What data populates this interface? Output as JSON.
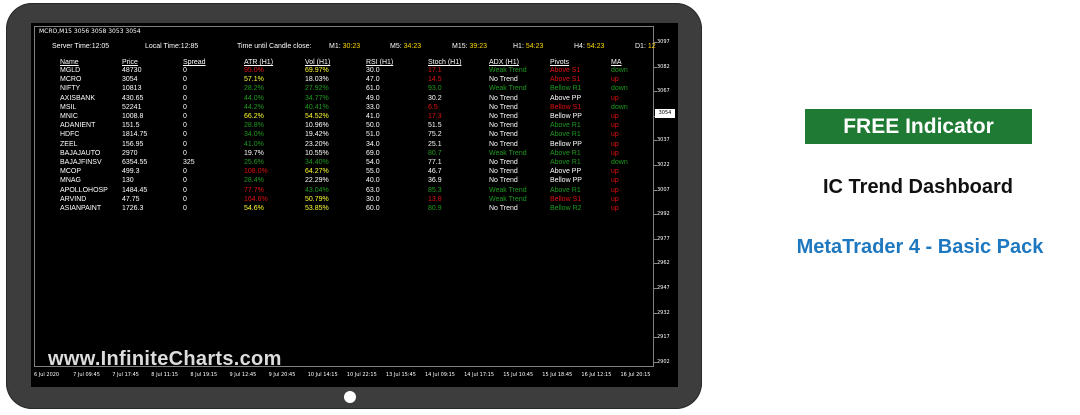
{
  "header": {
    "symbol_line": "MCRO,M15  3056 3058 3053 3054",
    "server_time_label": "Server Time:",
    "server_time": "12:05",
    "local_time_label": "Local Time:",
    "local_time": "12:85",
    "candle_label": "Time until Candle close:",
    "timers": [
      {
        "tf": "M1:",
        "value": "30:23"
      },
      {
        "tf": "M5:",
        "value": "34:23"
      },
      {
        "tf": "M15:",
        "value": "39:23"
      },
      {
        "tf": "H1:",
        "value": "54:23"
      },
      {
        "tf": "H4:",
        "value": "54:23"
      },
      {
        "tf": "D1:",
        "value": "12"
      }
    ]
  },
  "columns": [
    "Name",
    "Price",
    "Spread",
    "ATR (H1)",
    "Vol (H1)",
    "RSI (H1)",
    "Stoch (H1)",
    "ADX (H1)",
    "Pivots",
    "MA"
  ],
  "colors": {
    "white": "#ffffff",
    "red": "#e01010",
    "green": "#1e9a1e",
    "yellow": "#ffff33"
  },
  "rows": [
    {
      "name": "MGLD",
      "price": "48730",
      "spread": "0",
      "atr": "95.0%",
      "atr_c": "red",
      "vol": "69.97%",
      "vol_c": "yellow",
      "rsi": "30.0",
      "stoch": "17.1",
      "stoch_c": "red",
      "adx": "Weak Trend",
      "adx_c": "green",
      "pivots": "Above S1",
      "piv_c": "red",
      "ma": "down",
      "ma_c": "green"
    },
    {
      "name": "MCRO",
      "price": "3054",
      "spread": "0",
      "atr": "57.1%",
      "atr_c": "yellow",
      "vol": "18.03%",
      "vol_c": "white",
      "rsi": "47.0",
      "stoch": "14.5",
      "stoch_c": "red",
      "adx": "No Trend",
      "adx_c": "white",
      "pivots": "Above S1",
      "piv_c": "red",
      "ma": "up",
      "ma_c": "red"
    },
    {
      "name": "NIFTY",
      "price": "10813",
      "spread": "0",
      "atr": "28.2%",
      "atr_c": "green",
      "vol": "27.92%",
      "vol_c": "green",
      "rsi": "61.0",
      "stoch": "93.0",
      "stoch_c": "green",
      "adx": "Weak Trend",
      "adx_c": "green",
      "pivots": "Bellow R1",
      "piv_c": "green",
      "ma": "down",
      "ma_c": "green"
    },
    {
      "name": "AXISBANK",
      "price": "430.65",
      "spread": "0",
      "atr": "44.0%",
      "atr_c": "green",
      "vol": "34.77%",
      "vol_c": "green",
      "rsi": "49.0",
      "stoch": "30.2",
      "stoch_c": "white",
      "adx": "No Trend",
      "adx_c": "white",
      "pivots": "Above PP",
      "piv_c": "white",
      "ma": "up",
      "ma_c": "red"
    },
    {
      "name": "MSIL",
      "price": "52241",
      "spread": "0",
      "atr": "44.2%",
      "atr_c": "green",
      "vol": "40.41%",
      "vol_c": "green",
      "rsi": "33.0",
      "stoch": "6.5",
      "stoch_c": "red",
      "adx": "No Trend",
      "adx_c": "white",
      "pivots": "Bellow S1",
      "piv_c": "red",
      "ma": "down",
      "ma_c": "green"
    },
    {
      "name": "MNIC",
      "price": "1008.8",
      "spread": "0",
      "atr": "66.2%",
      "atr_c": "yellow",
      "vol": "54.52%",
      "vol_c": "yellow",
      "rsi": "41.0",
      "stoch": "17.3",
      "stoch_c": "red",
      "adx": "No Trend",
      "adx_c": "white",
      "pivots": "Bellow PP",
      "piv_c": "white",
      "ma": "up",
      "ma_c": "red"
    },
    {
      "name": "ADANIENT",
      "price": "151.5",
      "spread": "0",
      "atr": "28.8%",
      "atr_c": "green",
      "vol": "10.96%",
      "vol_c": "white",
      "rsi": "50.0",
      "stoch": "51.5",
      "stoch_c": "white",
      "adx": "No Trend",
      "adx_c": "white",
      "pivots": "Above R1",
      "piv_c": "green",
      "ma": "up",
      "ma_c": "red"
    },
    {
      "name": "HDFC",
      "price": "1814.75",
      "spread": "0",
      "atr": "34.0%",
      "atr_c": "green",
      "vol": "19.42%",
      "vol_c": "white",
      "rsi": "51.0",
      "stoch": "75.2",
      "stoch_c": "white",
      "adx": "No Trend",
      "adx_c": "white",
      "pivots": "Above R1",
      "piv_c": "green",
      "ma": "up",
      "ma_c": "red"
    },
    {
      "name": "ZEEL",
      "price": "156.95",
      "spread": "0",
      "atr": "41.0%",
      "atr_c": "green",
      "vol": "23.20%",
      "vol_c": "white",
      "rsi": "34.0",
      "stoch": "25.1",
      "stoch_c": "white",
      "adx": "No Trend",
      "adx_c": "white",
      "pivots": "Bellow PP",
      "piv_c": "white",
      "ma": "up",
      "ma_c": "red"
    },
    {
      "name": "BAJAJAUTO",
      "price": "2970",
      "spread": "0",
      "atr": "19.7%",
      "atr_c": "white",
      "vol": "10.55%",
      "vol_c": "white",
      "rsi": "69.0",
      "stoch": "80.7",
      "stoch_c": "green",
      "adx": "Weak Trend",
      "adx_c": "green",
      "pivots": "Above R1",
      "piv_c": "green",
      "ma": "up",
      "ma_c": "red"
    },
    {
      "name": "BAJAJFINSV",
      "price": "6354.55",
      "spread": "325",
      "atr": "25.6%",
      "atr_c": "green",
      "vol": "34.40%",
      "vol_c": "green",
      "rsi": "54.0",
      "stoch": "77.1",
      "stoch_c": "white",
      "adx": "No Trend",
      "adx_c": "white",
      "pivots": "Above R1",
      "piv_c": "green",
      "ma": "down",
      "ma_c": "green"
    },
    {
      "name": "MCOP",
      "price": "499.3",
      "spread": "0",
      "atr": "108.0%",
      "atr_c": "red",
      "vol": "64.27%",
      "vol_c": "yellow",
      "rsi": "55.0",
      "stoch": "46.7",
      "stoch_c": "white",
      "adx": "No Trend",
      "adx_c": "white",
      "pivots": "Above PP",
      "piv_c": "white",
      "ma": "up",
      "ma_c": "red"
    },
    {
      "name": "MNAG",
      "price": "130",
      "spread": "0",
      "atr": "28.4%",
      "atr_c": "green",
      "vol": "22.29%",
      "vol_c": "white",
      "rsi": "40.0",
      "stoch": "36.9",
      "stoch_c": "white",
      "adx": "No Trend",
      "adx_c": "white",
      "pivots": "Bellow PP",
      "piv_c": "white",
      "ma": "up",
      "ma_c": "red"
    },
    {
      "name": "APOLLOHOSP",
      "price": "1484.45",
      "spread": "0",
      "atr": "77.7%",
      "atr_c": "red",
      "vol": "43.04%",
      "vol_c": "green",
      "rsi": "63.0",
      "stoch": "85.3",
      "stoch_c": "green",
      "adx": "Weak Trend",
      "adx_c": "green",
      "pivots": "Above R1",
      "piv_c": "green",
      "ma": "up",
      "ma_c": "red"
    },
    {
      "name": "ARVIND",
      "price": "47.75",
      "spread": "0",
      "atr": "164.6%",
      "atr_c": "red",
      "vol": "50.79%",
      "vol_c": "yellow",
      "rsi": "30.0",
      "stoch": "13.8",
      "stoch_c": "red",
      "adx": "Weak Trend",
      "adx_c": "green",
      "pivots": "Bellow S1",
      "piv_c": "red",
      "ma": "up",
      "ma_c": "red"
    },
    {
      "name": "ASIANPAINT",
      "price": "1726.3",
      "spread": "0",
      "atr": "54.6%",
      "atr_c": "yellow",
      "vol": "53.85%",
      "vol_c": "yellow",
      "rsi": "60.0",
      "stoch": "80.9",
      "stoch_c": "green",
      "adx": "No Trend",
      "adx_c": "white",
      "pivots": "Bellow R2",
      "piv_c": "green",
      "ma": "up",
      "ma_c": "red"
    }
  ],
  "price_axis": [
    "3097",
    "3082",
    "3067",
    "3052",
    "3037",
    "3022",
    "3007",
    "2992",
    "2977",
    "2962",
    "2947",
    "2932",
    "2917",
    "2902"
  ],
  "current_price": "3054",
  "time_axis": [
    "6 Jul 2020",
    "7 Jul 09:45",
    "7 Jul 17:45",
    "8 Jul 11:15",
    "8 Jul 19:15",
    "9 Jul 12:45",
    "9 Jul 20:45",
    "10 Jul 14:15",
    "10 Jul 22:15",
    "13 Jul 15:45",
    "14 Jul 09:15",
    "14 Jul 17:15",
    "15 Jul 10:45",
    "15 Jul 18:45",
    "16 Jul 12:15",
    "16 Jul 20:15"
  ],
  "watermark": "www.InfiniteCharts.com",
  "promo": {
    "badge": "FREE Indicator",
    "title": "IC Trend Dashboard",
    "subtitle": "MetaTrader 4 - Basic Pack"
  }
}
